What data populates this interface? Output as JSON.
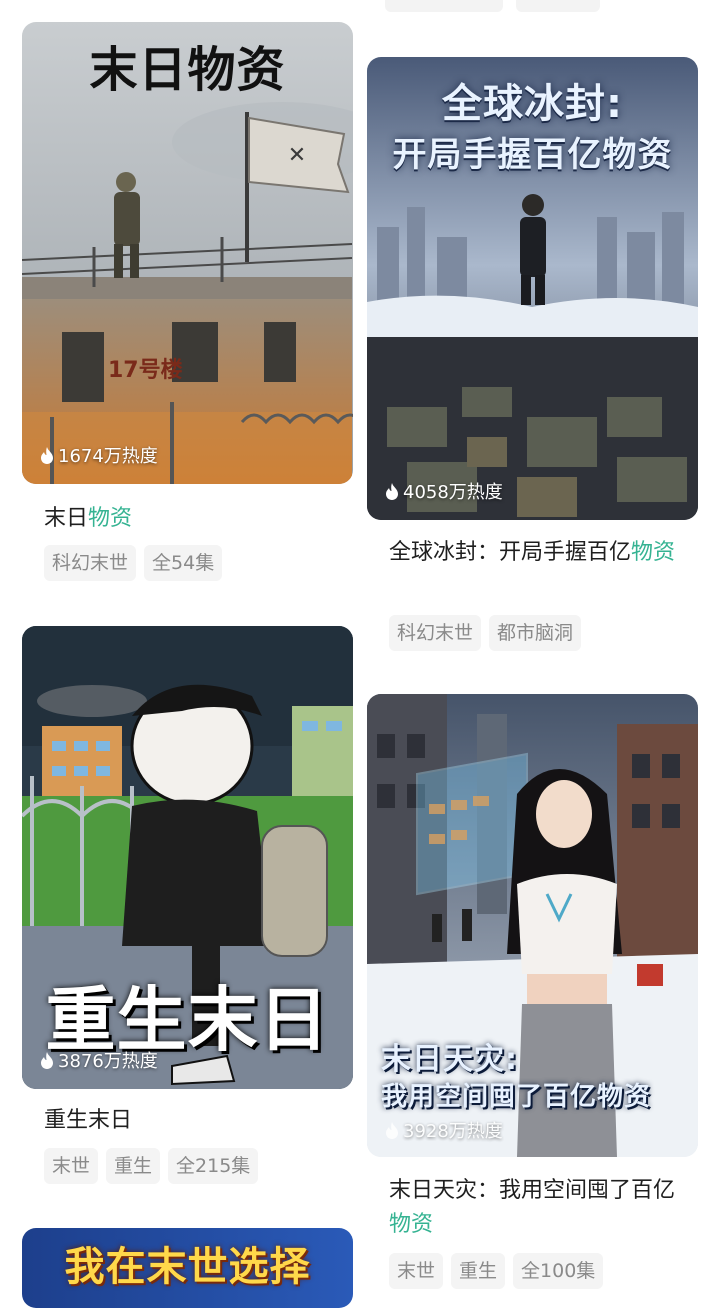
{
  "cards": [
    {
      "cover_title": "末日物资",
      "cover_sign": "17号楼",
      "heat": "1674万热度",
      "title_main": "末日",
      "title_highlight": "物资",
      "tags": [
        "科幻末世",
        "全54集"
      ]
    },
    {
      "cover_title_line1": "全球冰封:",
      "cover_title_line2": "开局手握百亿物资",
      "heat": "4058万热度",
      "title_main": "全球冰封：开局手握百亿",
      "title_highlight": "物资",
      "tags": [
        "科幻末世",
        "都市脑洞"
      ]
    },
    {
      "cover_title": "重生末日",
      "heat": "3876万热度",
      "title_main": "重生末日",
      "tags": [
        "末世",
        "重生",
        "全215集"
      ]
    },
    {
      "cover_title_line1": "末日天灾:",
      "cover_title_line2": "我用空间囤了百亿物资",
      "heat": "3928万热度",
      "title_main": "末日天灾：我用空间囤了百亿",
      "title_highlight": "物资",
      "tags": [
        "末世",
        "重生",
        "全100集"
      ]
    },
    {
      "cover_title": "我在末世选择"
    }
  ],
  "colors": {
    "highlight": "#35b392",
    "tag_bg": "#f4f4f4",
    "tag_text": "#8a8a8a"
  }
}
